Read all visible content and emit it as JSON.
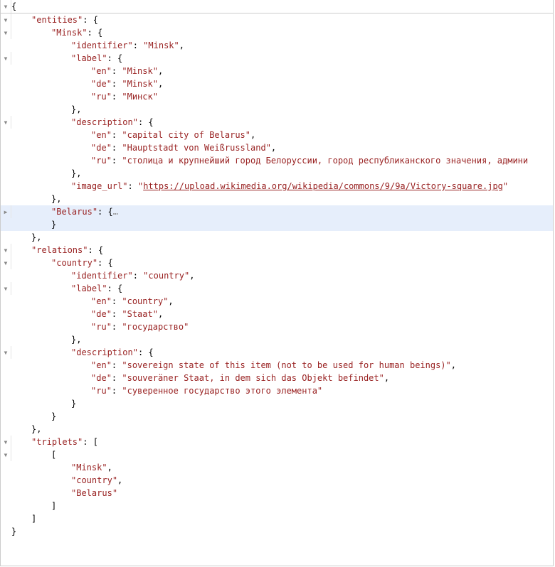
{
  "toggles": {
    "collapsed": "▸",
    "expanded": "▾"
  },
  "braces": {
    "open": "{",
    "close": "}",
    "openArr": "[",
    "closeArr": "]",
    "comma": ",",
    "colon": ": "
  },
  "json_top": {
    "entities_key": "entities",
    "minsk_key": "Minsk",
    "minsk_identifier_key": "identifier",
    "minsk_identifier_val": "Minsk",
    "label_key": "label",
    "label_en_key": "en",
    "label_en_val": "Minsk",
    "label_de_key": "de",
    "label_de_val": "Minsk",
    "label_ru_key": "ru",
    "label_ru_val": "Минск",
    "description_key": "description",
    "desc_en_key": "en",
    "desc_en_val": "capital city of Belarus",
    "desc_de_key": "de",
    "desc_de_val": "Hauptstadt von Weißrussland",
    "desc_ru_key": "ru",
    "desc_ru_val": "столица и крупнейший город Белоруссии, город республиканского значения, админи",
    "image_url_key": "image_url",
    "image_url_val": "https://upload.wikimedia.org/wikipedia/commons/9/9a/Victory-square.jpg",
    "belarus_key": "Belarus",
    "relations_key": "relations",
    "country_key": "country",
    "rel_identifier_key": "identifier",
    "rel_identifier_val": "country",
    "rel_label_key": "label",
    "rel_label_en_key": "en",
    "rel_label_en_val": "country",
    "rel_label_de_key": "de",
    "rel_label_de_val": "Staat",
    "rel_label_ru_key": "ru",
    "rel_label_ru_val": "государство",
    "rel_desc_key": "description",
    "rel_desc_en_key": "en",
    "rel_desc_en_val": "sovereign state of this item (not to be used for human beings)",
    "rel_desc_de_key": "de",
    "rel_desc_de_val": "souveräner Staat, in dem sich das Objekt befindet",
    "rel_desc_ru_key": "ru",
    "rel_desc_ru_val": "суверенное государство этого элемента",
    "triplets_key": "triplets",
    "trip0": "Minsk",
    "trip1": "country",
    "trip2": "Belarus",
    "ellipsis": "…"
  }
}
